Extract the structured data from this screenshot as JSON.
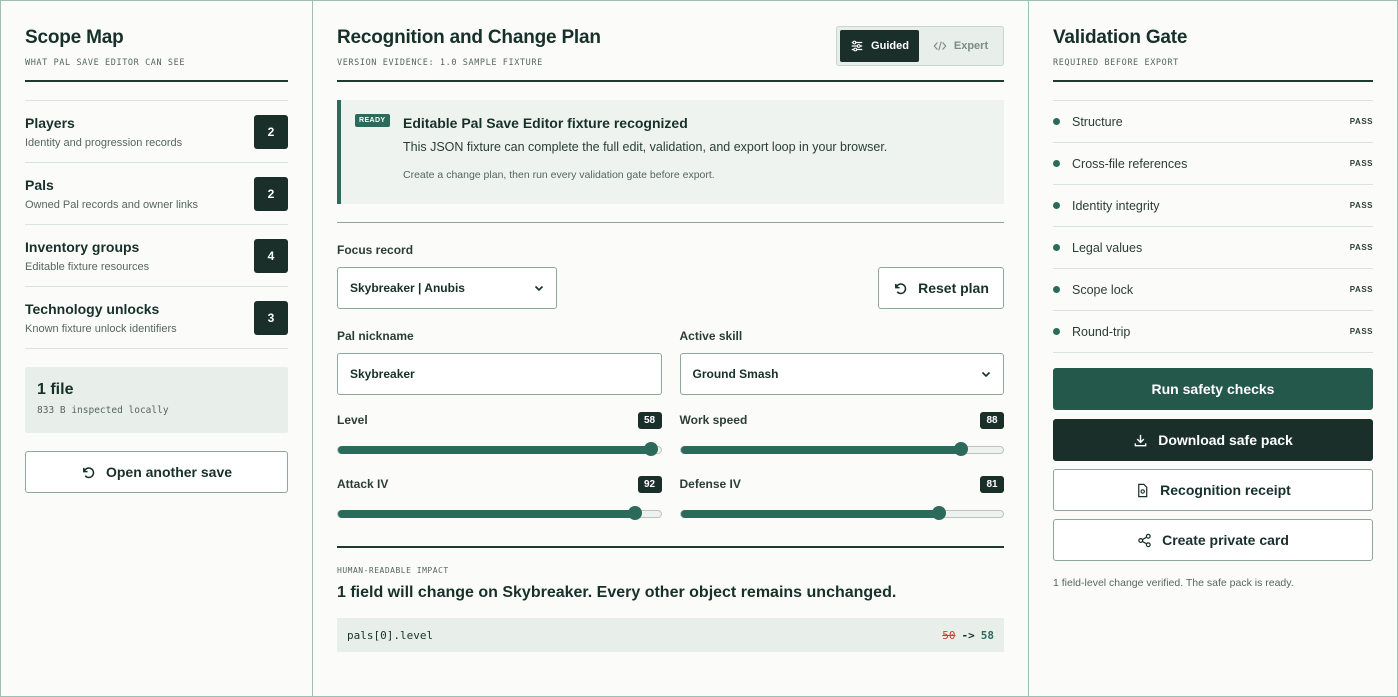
{
  "scope": {
    "title": "Scope Map",
    "subtitle": "WHAT PAL SAVE EDITOR CAN SEE",
    "items": [
      {
        "title": "Players",
        "desc": "Identity and progression records",
        "count": "2"
      },
      {
        "title": "Pals",
        "desc": "Owned Pal records and owner links",
        "count": "2"
      },
      {
        "title": "Inventory groups",
        "desc": "Editable fixture resources",
        "count": "4"
      },
      {
        "title": "Technology unlocks",
        "desc": "Known fixture unlock identifiers",
        "count": "3"
      }
    ],
    "file_title": "1 file",
    "file_sub": "833 B inspected locally",
    "open_button": "Open another save"
  },
  "plan": {
    "title": "Recognition and Change Plan",
    "subtitle": "VERSION EVIDENCE: 1.0 SAMPLE FIXTURE",
    "mode_guided": "Guided",
    "mode_expert": "Expert",
    "ready_badge": "READY",
    "ready_title": "Editable Pal Save Editor fixture recognized",
    "ready_desc": "This JSON fixture can complete the full edit, validation, and export loop in your browser.",
    "ready_hint": "Create a change plan, then run every validation gate before export.",
    "focus_label": "Focus record",
    "focus_value": "Skybreaker | Anubis",
    "reset_button": "Reset plan",
    "nickname_label": "Pal nickname",
    "nickname_value": "Skybreaker",
    "skill_label": "Active skill",
    "skill_value": "Ground Smash",
    "sliders": [
      {
        "label": "Level",
        "value": "58",
        "fraction": 0.97
      },
      {
        "label": "Work speed",
        "value": "88",
        "fraction": 0.87
      },
      {
        "label": "Attack IV",
        "value": "92",
        "fraction": 0.92
      },
      {
        "label": "Defense IV",
        "value": "81",
        "fraction": 0.8
      }
    ],
    "impact_label": "HUMAN-READABLE IMPACT",
    "impact_text": "1 field will change on Skybreaker. Every other object remains unchanged.",
    "diff_path": "pals[0].level",
    "diff_old": "50",
    "diff_arrow": "->",
    "diff_new": "58"
  },
  "gate": {
    "title": "Validation Gate",
    "subtitle": "REQUIRED BEFORE EXPORT",
    "checks": [
      {
        "name": "Structure",
        "status": "PASS"
      },
      {
        "name": "Cross-file references",
        "status": "PASS"
      },
      {
        "name": "Identity integrity",
        "status": "PASS"
      },
      {
        "name": "Legal values",
        "status": "PASS"
      },
      {
        "name": "Scope lock",
        "status": "PASS"
      },
      {
        "name": "Round-trip",
        "status": "PASS"
      }
    ],
    "run_button": "Run safety checks",
    "download_button": "Download safe pack",
    "receipt_button": "Recognition receipt",
    "card_button": "Create private card",
    "status": "1 field-level change verified. The safe pack is ready."
  },
  "colors": {
    "accent": "#2c6b5b",
    "dark": "#1b2f2a",
    "removed": "#c2452d"
  }
}
